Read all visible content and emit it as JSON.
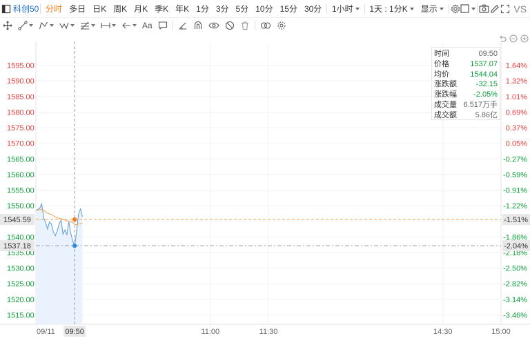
{
  "toolbar": {
    "symbol": "科创50",
    "periods": [
      {
        "label": "分时",
        "active": true
      },
      {
        "label": "多日"
      },
      {
        "label": "日K"
      },
      {
        "label": "周K"
      },
      {
        "label": "月K"
      },
      {
        "label": "季K"
      },
      {
        "label": "年K"
      },
      {
        "label": "1分"
      },
      {
        "label": "3分"
      },
      {
        "label": "5分"
      },
      {
        "label": "10分"
      },
      {
        "label": "15分"
      },
      {
        "label": "30分"
      }
    ],
    "hour_select": "1小时",
    "day_select": "1天 : 1分K",
    "display_select": "显示",
    "vs_label": "VS"
  },
  "drawing_tools": [
    "crosshair-icon",
    "trend-line-icon",
    "polyline-icon",
    "wave-icon",
    "fib-icon",
    "measure-icon",
    "arrow-icon",
    "text-icon",
    "comment-icon",
    "angle-icon",
    "magnet-icon",
    "eye-icon",
    "lock-icon",
    "trash-icon",
    "link-icon",
    "settings-icon"
  ],
  "drawing_text": "Aa",
  "info": {
    "rows": [
      {
        "k": "时间",
        "v": "09:50",
        "color": "normal"
      },
      {
        "k": "价格",
        "v": "1537.07",
        "color": "green"
      },
      {
        "k": "均价",
        "v": "1544.04",
        "color": "green"
      },
      {
        "k": "涨跌额",
        "v": "-32.15",
        "color": "green"
      },
      {
        "k": "涨跌幅",
        "v": "-2.05%",
        "color": "green"
      },
      {
        "k": "成交量",
        "v": "6.517万手",
        "color": "normal"
      },
      {
        "k": "成交额",
        "v": "5.86亿",
        "color": "normal"
      }
    ]
  },
  "colors": {
    "up": "#e03c3c",
    "down": "#0a9b3a",
    "price_line": "#5b9bd5",
    "avg_line": "#f0a050",
    "area_fill": "#eaf3fd",
    "ref_line": "#f0a050",
    "crosshair": "#999999",
    "label_bg": "#e8e8e8"
  },
  "chart_data": {
    "type": "line",
    "x": [
      "09:30",
      "09:31",
      "09:32",
      "09:33",
      "09:34",
      "09:35",
      "09:36",
      "09:37",
      "09:38",
      "09:39",
      "09:40",
      "09:41",
      "09:42",
      "09:43",
      "09:44",
      "09:45",
      "09:46",
      "09:47",
      "09:48",
      "09:49",
      "09:50",
      "09:51",
      "09:52",
      "09:53",
      "09:54"
    ],
    "series": [
      {
        "name": "价格",
        "values": [
          1548.5,
          1548.8,
          1549.2,
          1550.6,
          1546.2,
          1544.6,
          1542.5,
          1544.8,
          1544.2,
          1541.6,
          1540.4,
          1541.9,
          1544.2,
          1545.3,
          1540.9,
          1542.3,
          1540.8,
          1544.9,
          1541.2,
          1538.7,
          1537.1,
          1541.8,
          1547.3,
          1549.0,
          1546.5
        ]
      },
      {
        "name": "均价",
        "values": [
          1548.5,
          1548.6,
          1548.7,
          1548.9,
          1548.5,
          1548.1,
          1547.6,
          1547.4,
          1547.2,
          1546.8,
          1546.4,
          1546.1,
          1546.0,
          1545.9,
          1545.6,
          1545.4,
          1545.1,
          1545.1,
          1544.9,
          1544.6,
          1544.0,
          1543.9,
          1544.1,
          1544.3,
          1544.4
        ]
      }
    ],
    "prev_close": 1569.22,
    "ylim": [
      1512.0,
      1600.0
    ],
    "left_ticks": [
      1595.0,
      1590.0,
      1585.0,
      1580.0,
      1575.0,
      1570.0,
      1565.0,
      1560.0,
      1555.0,
      1550.0,
      1545.0,
      1540.0,
      1535.0,
      1530.0,
      1525.0,
      1520.0,
      1515.0
    ],
    "left_tick_labels": [
      "1595.00",
      "1590.00",
      "1585.00",
      "1580.00",
      "1575.00",
      "1570.00",
      "1565.00",
      "1560.00",
      "1555.00",
      "1550.00",
      "1545.00",
      "1540.00",
      "1535.00",
      "1530.00",
      "1525.00",
      "1520.00",
      "1515.00"
    ],
    "right_tick_labels": [
      "1.64%",
      "1.32%",
      "1.01%",
      "0.69%",
      "0.37%",
      "0.05%",
      "-0.27%",
      "-0.59%",
      "-0.91%",
      "-1.22%",
      "-1.54%",
      "-1.86%",
      "-2.18%",
      "-2.50%",
      "-2.82%",
      "-3.14%",
      "-3.46%"
    ],
    "crosshair_time": "09:50",
    "crosshair_price": 1537.18,
    "crosshair_price_label": "1537.18",
    "crosshair_pct_label": "-2.04%",
    "avg_marker_price": 1545.59,
    "avg_marker_label": "1545.59",
    "avg_marker_pct_label": "-1.51%",
    "x_axis_labels": [
      {
        "time": "09:30",
        "label": "09/11"
      },
      {
        "time": "09:50",
        "label": "09:50"
      },
      {
        "time": "11:00",
        "label": "11:00"
      },
      {
        "time": "11:30",
        "label": "11:30"
      },
      {
        "time": "14:30",
        "label": "14:30"
      },
      {
        "time": "15:00",
        "label": "15:00"
      }
    ]
  }
}
